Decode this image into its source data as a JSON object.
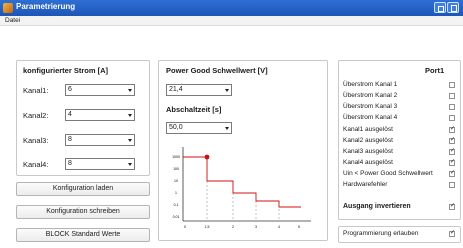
{
  "window": {
    "title": "Parametrierung"
  },
  "menu": {
    "items": [
      "Datei"
    ]
  },
  "strom": {
    "header": "konfigurierter Strom [A]",
    "channels": [
      {
        "label": "Kanal1:",
        "value": "6"
      },
      {
        "label": "Kanal2:",
        "value": "4"
      },
      {
        "label": "Kanal3:",
        "value": "8"
      },
      {
        "label": "Kanal4:",
        "value": "8"
      }
    ]
  },
  "buttons": {
    "load": "Konfiguration laden",
    "write": "Konfiguration schreiben",
    "block": "BLOCK Standard Werte"
  },
  "powergood": {
    "header": "Power Good Schwellwert [V]",
    "value": "21,4",
    "abschalt_header": "Abschaltzeit [s]",
    "abschalt_value": "50,0"
  },
  "port": {
    "header": "Port1",
    "rows": [
      {
        "label": "Überstrom Kanal 1",
        "checked": false
      },
      {
        "label": "Überstrom Kanal 2",
        "checked": false
      },
      {
        "label": "Überstrom Kanal 3",
        "checked": false
      },
      {
        "label": "Überstrom Kanal 4",
        "checked": false
      },
      {
        "label": "Kanal1 ausgelöst",
        "checked": true
      },
      {
        "label": "Kanal2 ausgelöst",
        "checked": true
      },
      {
        "label": "Kanal3 ausgelöst",
        "checked": true
      },
      {
        "label": "Kanal4 ausgelöst",
        "checked": true
      },
      {
        "label": "Uin < Power Good Schwellwert",
        "checked": true
      },
      {
        "label": "Hardwarefehler",
        "checked": false
      }
    ],
    "invert_label": "Ausgang invertieren",
    "invert_checked": true,
    "prog_label": "Programmierung erlauben",
    "prog_checked": true
  },
  "graph": {
    "y_ticks": [
      "1000",
      "100",
      "10",
      "1",
      "0.1",
      "0.01"
    ],
    "x_ticks": [
      "0",
      "1,5",
      "2",
      "3",
      "4",
      "5"
    ]
  }
}
